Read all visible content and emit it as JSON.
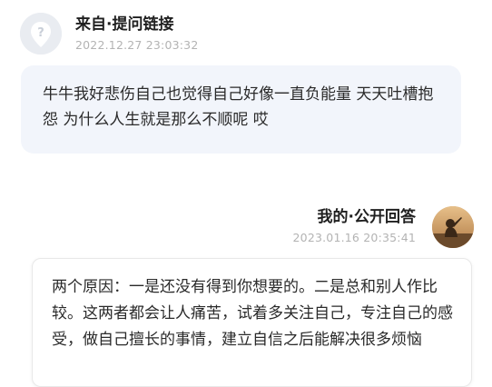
{
  "question": {
    "author_label": "来自·提问链接",
    "time": "2022.12.27 23:03:32",
    "text": "牛牛我好悲伤自己也觉得自己好像一直负能量 天天吐槽抱怨 为什么人生就是那么不顺呢 哎",
    "avatar_icon": "anonymous-question-avatar"
  },
  "answer": {
    "author_label": "我的·公开回答",
    "time": "2023.01.16 20:35:41",
    "text": "两个原因：一是还没有得到你想要的。二是总和别人作比较。这两者都会让人痛苦，试着多关注自己，专注自己的感受，做自己擅长的事情，建立自信之后能解决很多烦恼",
    "avatar_icon": "user-photo-avatar"
  },
  "colors": {
    "question_bubble": "#f2f5fb",
    "timestamp": "#b3b3b3"
  }
}
